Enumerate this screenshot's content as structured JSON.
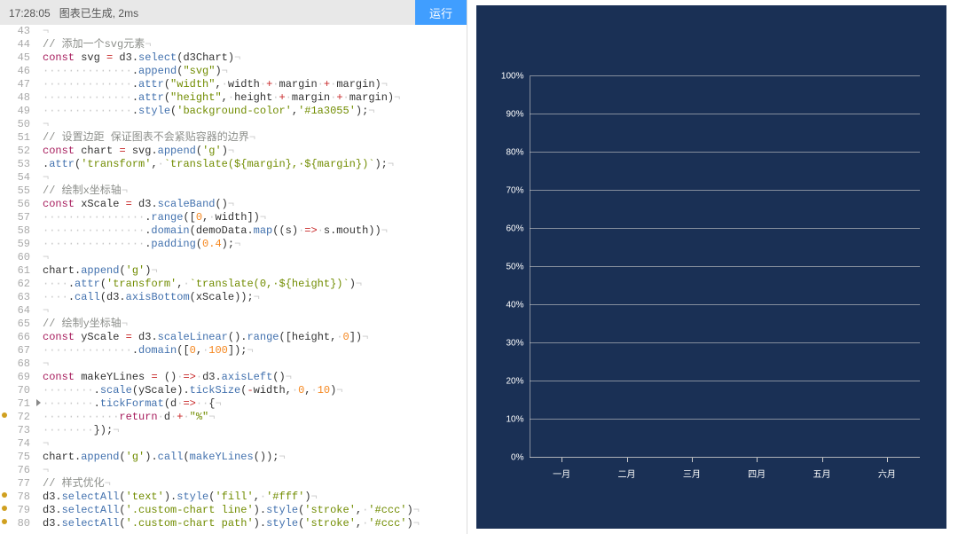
{
  "header": {
    "timestamp": "17:28:05",
    "status_text": "图表已生成, 2ms",
    "run_label": "运行"
  },
  "chart_data": {
    "type": "bar",
    "categories": [
      "一月",
      "二月",
      "三月",
      "四月",
      "五月",
      "六月"
    ],
    "values": [
      null,
      null,
      null,
      null,
      null,
      null
    ],
    "ylabel": "",
    "xlabel": "",
    "ylim": [
      0,
      100
    ],
    "y_ticks": [
      "0%",
      "10%",
      "20%",
      "30%",
      "40%",
      "50%",
      "60%",
      "70%",
      "80%",
      "90%",
      "100%"
    ],
    "background": "#1a3055"
  },
  "code": {
    "start_line": 43,
    "lines": [
      {
        "n": 43,
        "html": "<span class='tok-ws'>¬</span>"
      },
      {
        "n": 44,
        "html": "<span class='tok-comment'>// 添加一个svg元素</span><span class='tok-ws'>¬</span>"
      },
      {
        "n": 45,
        "html": "<span class='tok-kw'>const</span> <span class='tok-var'>svg</span> <span class='tok-op'>=</span> d3.<span class='tok-func'>select</span>(d3Chart)<span class='tok-ws'>¬</span>"
      },
      {
        "n": 46,
        "html": "<span class='tok-ws'>··············</span>.<span class='tok-func'>append</span>(<span class='tok-str'>\"svg\"</span>)<span class='tok-ws'>¬</span>"
      },
      {
        "n": 47,
        "html": "<span class='tok-ws'>··············</span>.<span class='tok-func'>attr</span>(<span class='tok-str'>\"width\"</span>,<span class='tok-ws'>·</span>width<span class='tok-ws'>·</span><span class='tok-op'>+</span><span class='tok-ws'>·</span>margin<span class='tok-ws'>·</span><span class='tok-op'>+</span><span class='tok-ws'>·</span>margin)<span class='tok-ws'>¬</span>"
      },
      {
        "n": 48,
        "html": "<span class='tok-ws'>··············</span>.<span class='tok-func'>attr</span>(<span class='tok-str'>\"height\"</span>,<span class='tok-ws'>·</span>height<span class='tok-ws'>·</span><span class='tok-op'>+</span><span class='tok-ws'>·</span>margin<span class='tok-ws'>·</span><span class='tok-op'>+</span><span class='tok-ws'>·</span>margin)<span class='tok-ws'>¬</span>"
      },
      {
        "n": 49,
        "html": "<span class='tok-ws'>··············</span>.<span class='tok-func'>style</span>(<span class='tok-str'>'background-color'</span>,<span class='tok-str'>'#1a3055'</span>);<span class='tok-ws'>¬</span>"
      },
      {
        "n": 50,
        "html": "<span class='tok-ws'>¬</span>"
      },
      {
        "n": 51,
        "html": "<span class='tok-comment'>// 设置边距 保证图表不会紧贴容器的边界</span><span class='tok-ws'>¬</span>"
      },
      {
        "n": 52,
        "html": "<span class='tok-kw'>const</span> <span class='tok-var'>chart</span> <span class='tok-op'>=</span> svg.<span class='tok-func'>append</span>(<span class='tok-str'>'g'</span>)<span class='tok-ws'>¬</span>"
      },
      {
        "n": 53,
        "html": ".<span class='tok-func'>attr</span>(<span class='tok-str'>'transform'</span>,<span class='tok-ws'>·</span><span class='tok-str'>`translate(${margin},·${margin})`</span>);<span class='tok-ws'>¬</span>"
      },
      {
        "n": 54,
        "html": "<span class='tok-ws'>¬</span>"
      },
      {
        "n": 55,
        "html": "<span class='tok-comment'>// 绘制x坐标轴</span><span class='tok-ws'>¬</span>"
      },
      {
        "n": 56,
        "html": "<span class='tok-kw'>const</span> <span class='tok-var'>xScale</span> <span class='tok-op'>=</span> d3.<span class='tok-func'>scaleBand</span>()<span class='tok-ws'>¬</span>"
      },
      {
        "n": 57,
        "html": "<span class='tok-ws'>················</span>.<span class='tok-func'>range</span>([<span class='tok-num'>0</span>,<span class='tok-ws'>·</span>width])<span class='tok-ws'>¬</span>"
      },
      {
        "n": 58,
        "html": "<span class='tok-ws'>················</span>.<span class='tok-func'>domain</span>(demoData.<span class='tok-func'>map</span>((s)<span class='tok-ws'>·</span><span class='tok-op'>=></span><span class='tok-ws'>·</span>s.mouth))<span class='tok-ws'>¬</span>"
      },
      {
        "n": 59,
        "html": "<span class='tok-ws'>················</span>.<span class='tok-func'>padding</span>(<span class='tok-num'>0.4</span>);<span class='tok-ws'>¬</span>"
      },
      {
        "n": 60,
        "html": "<span class='tok-ws'>¬</span>"
      },
      {
        "n": 61,
        "html": "chart.<span class='tok-func'>append</span>(<span class='tok-str'>'g'</span>)<span class='tok-ws'>¬</span>"
      },
      {
        "n": 62,
        "html": "<span class='tok-ws'>····</span>.<span class='tok-func'>attr</span>(<span class='tok-str'>'transform'</span>,<span class='tok-ws'>·</span><span class='tok-str'>`translate(0,·${height})`</span>)<span class='tok-ws'>¬</span>"
      },
      {
        "n": 63,
        "html": "<span class='tok-ws'>····</span>.<span class='tok-func'>call</span>(d3.<span class='tok-func'>axisBottom</span>(xScale));<span class='tok-ws'>¬</span>"
      },
      {
        "n": 64,
        "html": "<span class='tok-ws'>¬</span>"
      },
      {
        "n": 65,
        "html": "<span class='tok-comment'>// 绘制y坐标轴</span><span class='tok-ws'>¬</span>"
      },
      {
        "n": 66,
        "html": "<span class='tok-kw'>const</span> <span class='tok-var'>yScale</span> <span class='tok-op'>=</span> d3.<span class='tok-func'>scaleLinear</span>().<span class='tok-func'>range</span>([height,<span class='tok-ws'>·</span><span class='tok-num'>0</span>])<span class='tok-ws'>¬</span>"
      },
      {
        "n": 67,
        "html": "<span class='tok-ws'>··············</span>.<span class='tok-func'>domain</span>([<span class='tok-num'>0</span>,<span class='tok-ws'>·</span><span class='tok-num'>100</span>]);<span class='tok-ws'>¬</span>"
      },
      {
        "n": 68,
        "html": "<span class='tok-ws'>¬</span>"
      },
      {
        "n": 69,
        "html": "<span class='tok-kw'>const</span> <span class='tok-var'>makeYLines</span> <span class='tok-op'>=</span> ()<span class='tok-ws'>·</span><span class='tok-op'>=></span><span class='tok-ws'>·</span>d3.<span class='tok-func'>axisLeft</span>()<span class='tok-ws'>¬</span>"
      },
      {
        "n": 70,
        "html": "<span class='tok-ws'>········</span>.<span class='tok-func'>scale</span>(yScale).<span class='tok-func'>tickSize</span>(<span class='tok-op'>-</span>width,<span class='tok-ws'>·</span><span class='tok-num'>0</span>,<span class='tok-ws'>·</span><span class='tok-num'>10</span>)<span class='tok-ws'>¬</span>"
      },
      {
        "n": 71,
        "fold": true,
        "html": "<span class='tok-ws'>········</span>.<span class='tok-func'>tickFormat</span>(d<span class='tok-ws'>·</span><span class='tok-op'>=></span><span class='tok-ws'>··</span>{<span class='tok-ws'>¬</span>"
      },
      {
        "n": 72,
        "mark": true,
        "html": "<span class='tok-ws'>············</span><span class='tok-kw'>return</span><span class='tok-ws'>·</span>d<span class='tok-ws'>·</span><span class='tok-op'>+</span><span class='tok-ws'>·</span><span class='tok-str'>\"%\"</span><span class='tok-ws'>¬</span>"
      },
      {
        "n": 73,
        "html": "<span class='tok-ws'>········</span>});<span class='tok-ws'>¬</span>"
      },
      {
        "n": 74,
        "html": "<span class='tok-ws'>¬</span>"
      },
      {
        "n": 75,
        "html": "chart.<span class='tok-func'>append</span>(<span class='tok-str'>'g'</span>).<span class='tok-func'>call</span>(<span class='tok-func'>makeYLines</span>());<span class='tok-ws'>¬</span>"
      },
      {
        "n": 76,
        "html": "<span class='tok-ws'>¬</span>"
      },
      {
        "n": 77,
        "html": "<span class='tok-comment'>// 样式优化</span><span class='tok-ws'>¬</span>"
      },
      {
        "n": 78,
        "mark": true,
        "html": "d3.<span class='tok-func'>selectAll</span>(<span class='tok-str'>'text'</span>).<span class='tok-func'>style</span>(<span class='tok-str'>'fill'</span>,<span class='tok-ws'>·</span><span class='tok-str'>'#fff'</span>)<span class='tok-ws'>¬</span>"
      },
      {
        "n": 79,
        "mark": true,
        "html": "d3.<span class='tok-func'>selectAll</span>(<span class='tok-str'>'.custom-chart line'</span>).<span class='tok-func'>style</span>(<span class='tok-str'>'stroke'</span>,<span class='tok-ws'>·</span><span class='tok-str'>'#ccc'</span>)<span class='tok-ws'>¬</span>"
      },
      {
        "n": 80,
        "mark": true,
        "html": "d3.<span class='tok-func'>selectAll</span>(<span class='tok-str'>'.custom-chart path'</span>).<span class='tok-func'>style</span>(<span class='tok-str'>'stroke'</span>,<span class='tok-ws'>·</span><span class='tok-str'>'#ccc'</span>)<span class='tok-ws'>¬</span>"
      }
    ]
  }
}
